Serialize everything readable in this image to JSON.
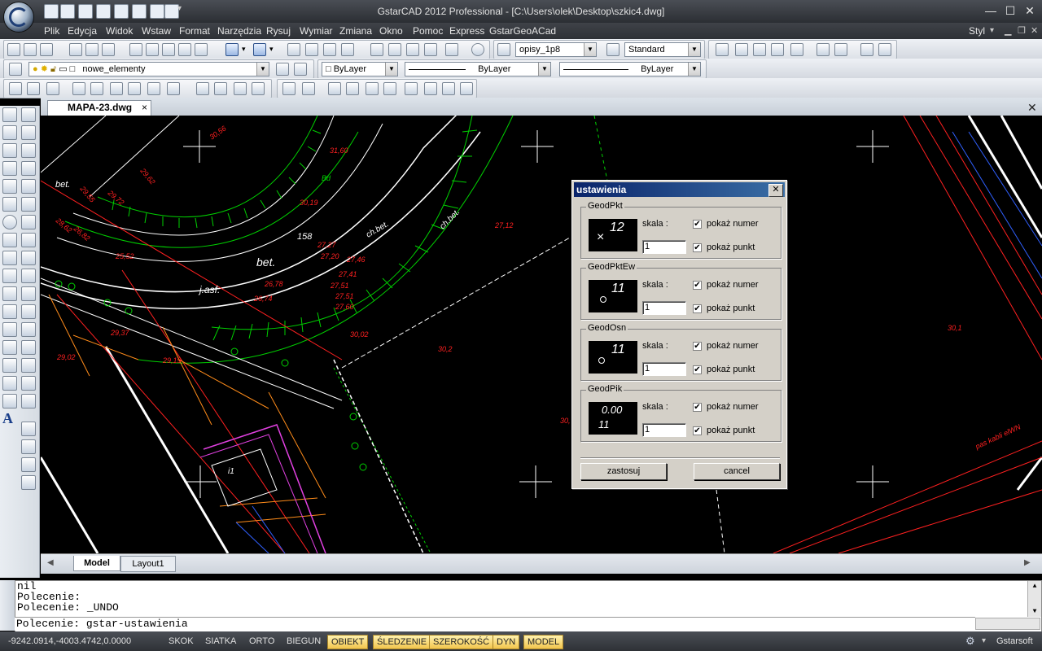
{
  "window": {
    "title": "GstarCAD 2012 Professional - [C:\\Users\\olek\\Desktop\\szkic4.dwg]",
    "minimize": "—",
    "maximize": "☐",
    "close": "✕",
    "style_label": "Styl"
  },
  "menu": [
    "Plik",
    "Edycja",
    "Widok",
    "Wstaw",
    "Format",
    "Narzędzia",
    "Rysuj",
    "Wymiar",
    "Zmiana",
    "Okno",
    "Pomoc",
    "Express",
    "GstarGeoACad"
  ],
  "toolbar": {
    "text_style": "opisy_1p8",
    "dim_style": "Standard",
    "layer": "nowe_elementy",
    "color": "ByLayer",
    "linetype": "ByLayer",
    "lineweight": "ByLayer"
  },
  "document": {
    "tab_label": "MAPA-23.dwg",
    "tab_close": "×",
    "layout_tabs": [
      "Model",
      "Layout1"
    ]
  },
  "drawing_text": {
    "labels": [
      "30,56",
      "31,60",
      "Bd",
      "bet.",
      "29,62",
      "29,55",
      "29,72",
      "30,19",
      "158",
      "ch.bet.",
      "ch.bet.",
      "27,12",
      "bet.",
      "28,62",
      "26,82",
      "25,52",
      "27,27",
      "27,20",
      "27,46",
      "j.asf.",
      "26,78",
      "27,51",
      "27,41",
      "26,74",
      "27,51",
      "27,60",
      "30,02",
      "29,37",
      "29,02",
      "29,19",
      "30,2",
      "30,1",
      "i1",
      "30,",
      "pas kabli elWN"
    ]
  },
  "dialog": {
    "title": "ustawienia",
    "close": "✕",
    "groups": [
      {
        "name": "GeodPkt",
        "scale_label": "skala :",
        "scale_value": "1",
        "show_number": "pokaż numer",
        "show_point": "pokaż punkt",
        "preview_text": "12"
      },
      {
        "name": "GeodPktEw",
        "scale_label": "skala :",
        "scale_value": "1",
        "show_number": "pokaż numer",
        "show_point": "pokaż punkt",
        "preview_text": "11"
      },
      {
        "name": "GeodOsn",
        "scale_label": "skala :",
        "scale_value": "1",
        "show_number": "pokaż numer",
        "show_point": "pokaż punkt",
        "preview_text": "11"
      },
      {
        "name": "GeodPik",
        "scale_label": "skala :",
        "scale_value": "1",
        "show_number": "pokaż numer",
        "show_point": "pokaż punkt",
        "preview_text": "0.00",
        "preview_text2": "11"
      }
    ],
    "apply": "zastosuj",
    "cancel": "cancel"
  },
  "command": {
    "history": [
      "nil",
      "Polecenie:",
      "Polecenie: _UNDO"
    ],
    "current": "Polecenie: gstar-ustawienia"
  },
  "status": {
    "coords": "-9242.0914,-4003.4742,0.0000",
    "toggles": [
      {
        "label": "SKOK",
        "on": false
      },
      {
        "label": "SIATKA",
        "on": false
      },
      {
        "label": "ORTO",
        "on": false
      },
      {
        "label": "BIEGUN",
        "on": false
      },
      {
        "label": "OBIEKT",
        "on": true
      },
      {
        "label": "ŚLEDZENIE",
        "on": true
      },
      {
        "label": "SZEROKOŚĆ",
        "on": true
      },
      {
        "label": "DYN",
        "on": true
      },
      {
        "label": "MODEL",
        "on": true
      }
    ],
    "brand": "Gstarsoft"
  },
  "colors": {
    "title_gradient_start": "#0a246a",
    "title_gradient_end": "#3a6ea5",
    "status_on": "#f2c54c",
    "cad_green": "#00d000",
    "cad_red": "#ff2020",
    "cad_orange": "#ff8c1a",
    "cad_magenta": "#e040e0"
  }
}
